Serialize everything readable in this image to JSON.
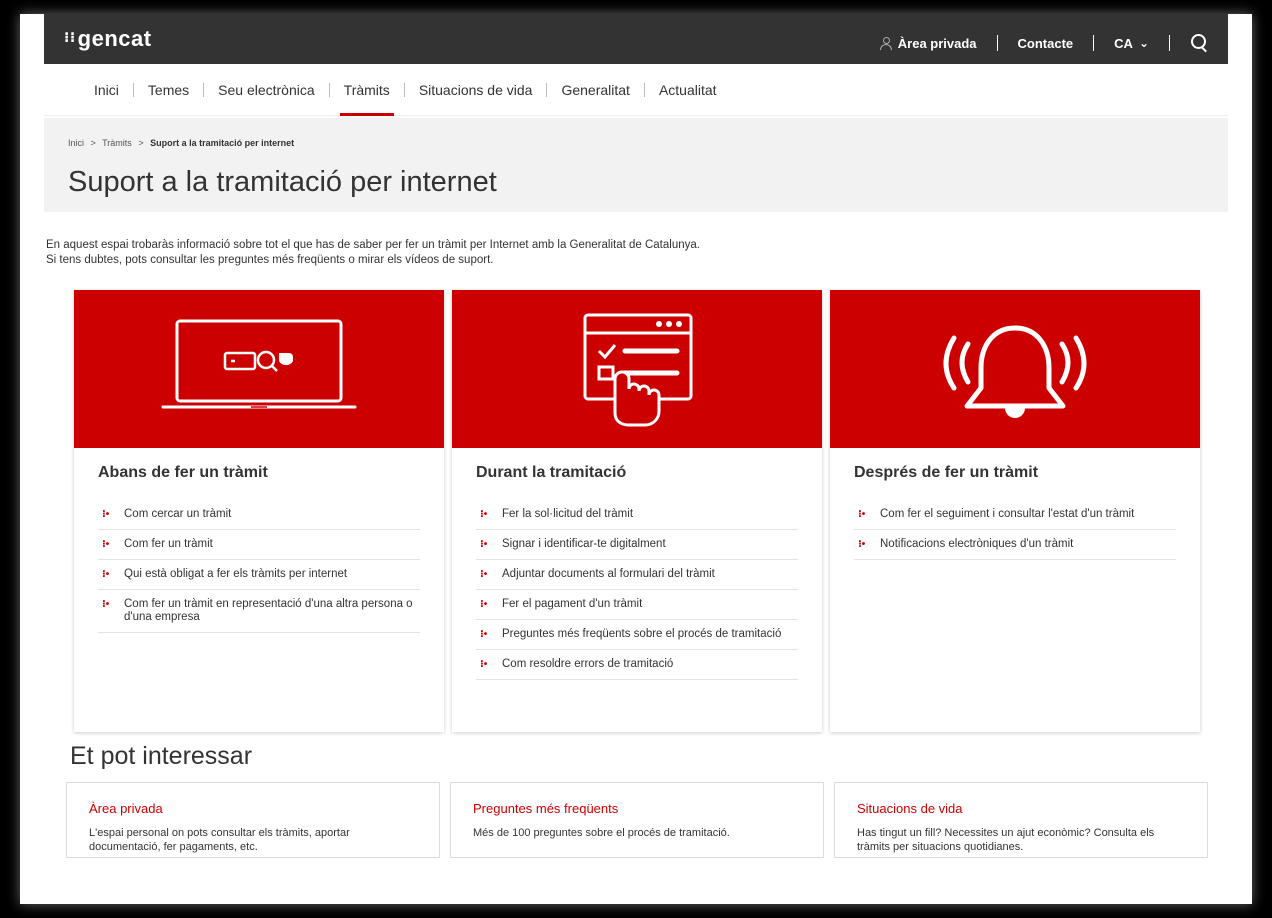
{
  "brand": {
    "logo": "gencat",
    "accent": "#cc0000"
  },
  "topbar": {
    "area_privada": "Àrea privada",
    "contacte": "Contacte",
    "lang": "CA",
    "lang_chevron": "⌄"
  },
  "nav": {
    "items": [
      "Inici",
      "Temes",
      "Seu electrònica",
      "Tràmits",
      "Situacions de vida",
      "Generalitat",
      "Actualitat"
    ],
    "active": "Tràmits"
  },
  "breadcrumb": {
    "items": [
      "Inici",
      "Tràmits"
    ],
    "sep": ">",
    "current": "Suport a la tramitació per internet"
  },
  "page": {
    "title": "Suport a la tramitació per internet",
    "intro_line1": "En aquest espai trobaràs informació sobre tot el que has de saber per fer un tràmit per Internet amb la Generalitat de Catalunya.",
    "intro_line2": "Si tens dubtes, pots consultar les preguntes més freqüents o mirar els vídeos de suport."
  },
  "cards": [
    {
      "icon": "laptop-search-icon",
      "title": "Abans de fer un tràmit",
      "links": [
        "Com cercar un tràmit",
        "Com fer un tràmit",
        "Qui està obligat a fer els tràmits per internet",
        "Com fer un tràmit en representació d'una altra persona o d'una empresa"
      ]
    },
    {
      "icon": "form-checklist-hand-icon",
      "title": "Durant la tramitació",
      "links": [
        "Fer la sol·licitud del tràmit",
        "Signar i identificar-te digitalment",
        "Adjuntar documents al formulari del tràmit",
        "Fer el pagament d'un tràmit",
        "Preguntes més freqüents sobre el procés de tramitació",
        "Com resoldre errors de tramitació"
      ]
    },
    {
      "icon": "bell-alert-icon",
      "title": "Després de fer un tràmit",
      "links": [
        "Com fer el seguiment i consultar l'estat d'un tràmit",
        "Notificacions electròniques d'un tràmit"
      ]
    }
  ],
  "interest": {
    "title": "Et pot interessar",
    "boxes": [
      {
        "title": "Àrea privada",
        "desc": "L'espai personal on pots consultar els tràmits, aportar documentació, fer pagaments, etc."
      },
      {
        "title": "Preguntes més freqüents",
        "desc": "Més de 100 preguntes sobre el procés de tramitació."
      },
      {
        "title": "Situacions de vida",
        "desc": "Has tingut un fill? Necessites un ajut econòmic? Consulta els tràmits per situacions quotidianes."
      }
    ]
  }
}
